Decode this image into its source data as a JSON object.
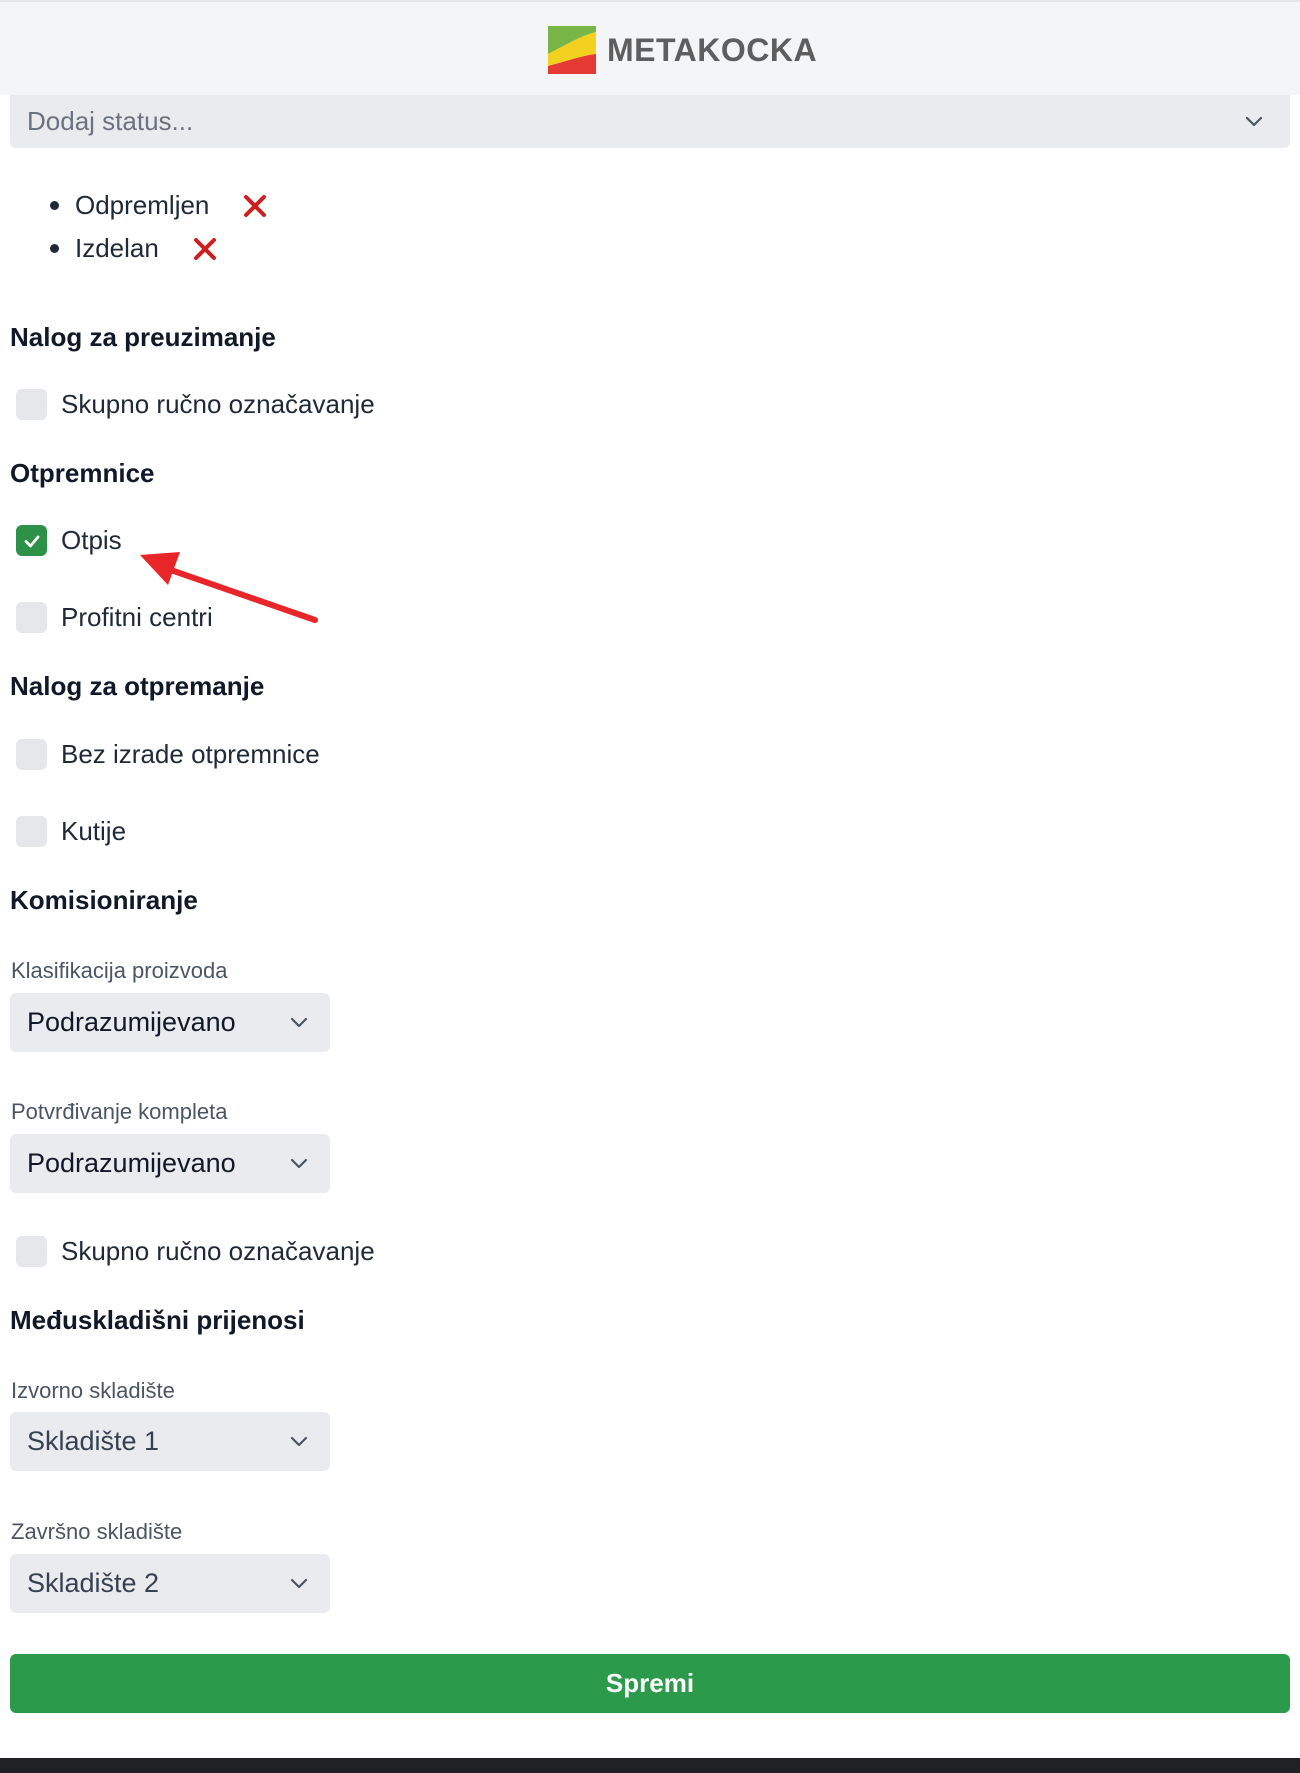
{
  "header": {
    "logo_text": "METAKOCKA",
    "logo_colors": {
      "green": "#79b648",
      "yellow": "#f3d21f",
      "red": "#e43a33"
    }
  },
  "status_select": {
    "placeholder": "Dodaj status..."
  },
  "statuses": [
    {
      "label": "Odpremljen"
    },
    {
      "label": "Izdelan"
    }
  ],
  "sections": {
    "pickup": {
      "title": "Nalog za preuzimanje",
      "bulk_manual": {
        "label": "Skupno ručno označavanje",
        "checked": false
      }
    },
    "delivery_notes": {
      "title": "Otpremnice",
      "writeoff": {
        "label": "Otpis",
        "checked": true
      },
      "profit_centers": {
        "label": "Profitni centri",
        "checked": false
      }
    },
    "shipping": {
      "title": "Nalog za otpremanje",
      "no_delivery_note": {
        "label": "Bez izrade otpremnice",
        "checked": false
      },
      "boxes": {
        "label": "Kutije",
        "checked": false
      }
    },
    "picking": {
      "title": "Komisioniranje",
      "classification": {
        "label": "Klasifikacija proizvoda",
        "value": "Podrazumijevano"
      },
      "kit_confirmation": {
        "label": "Potvrđivanje kompleta",
        "value": "Podrazumijevano"
      },
      "bulk_manual": {
        "label": "Skupno ručno označavanje",
        "checked": false
      }
    },
    "transfers": {
      "title": "Međuskladišni prijenosi",
      "source": {
        "label": "Izvorno skladište",
        "value": "Skladište 1"
      },
      "target": {
        "label": "Završno skladište",
        "value": "Skladište 2"
      }
    }
  },
  "save_button": {
    "label": "Spremi"
  },
  "colors": {
    "accent_green": "#2c9a4b",
    "remove_red": "#cc1f1f",
    "annotation_arrow": "#e8262a"
  }
}
